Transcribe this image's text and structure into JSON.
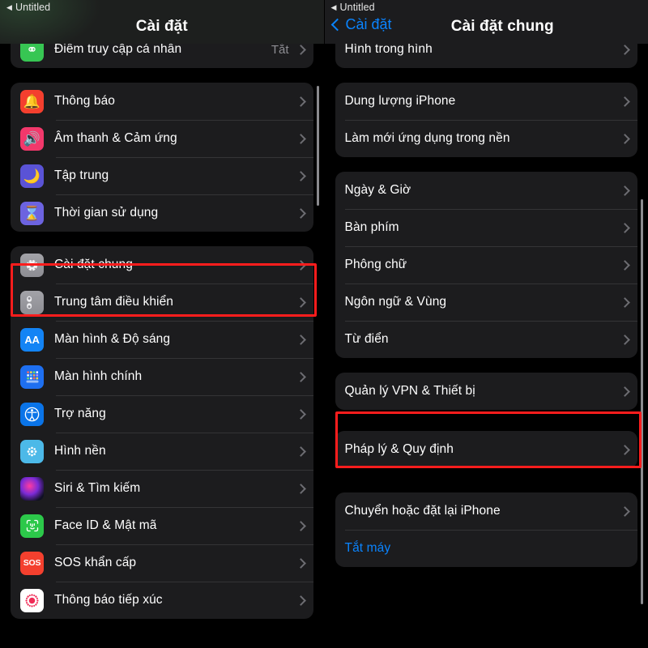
{
  "window": {
    "title": "Untitled",
    "back_glyph": "◀"
  },
  "left_screen": {
    "nav": {
      "title": "Cài đặt"
    },
    "scroll_groups": [
      {
        "name": "partial-top-group",
        "rows": [
          {
            "label": "Điểm truy cập cá nhân",
            "value": "Tắt",
            "icon": "hotspot-icon",
            "chevron": true
          }
        ]
      },
      {
        "name": "notifications-group",
        "rows": [
          {
            "label": "Thông báo",
            "value": "",
            "icon": "bell-icon",
            "chevron": true
          },
          {
            "label": "Âm thanh & Cảm ứng",
            "value": "",
            "icon": "speaker-icon",
            "chevron": true
          },
          {
            "label": "Tập trung",
            "value": "",
            "icon": "moon-icon",
            "chevron": true
          },
          {
            "label": "Thời gian sử dụng",
            "value": "",
            "icon": "hourglass-icon",
            "chevron": true
          }
        ]
      },
      {
        "name": "system-group",
        "rows": [
          {
            "label": "Cài đặt chung",
            "value": "",
            "icon": "gear-icon",
            "chevron": true
          },
          {
            "label": "Trung tâm điều khiển",
            "value": "",
            "icon": "control-center-icon",
            "chevron": true
          },
          {
            "label": "Màn hình & Độ sáng",
            "value": "",
            "icon": "display-aa-icon",
            "chevron": true
          },
          {
            "label": "Màn hình chính",
            "value": "",
            "icon": "home-screen-icon",
            "chevron": true
          },
          {
            "label": "Trợ năng",
            "value": "",
            "icon": "accessibility-icon",
            "chevron": true
          },
          {
            "label": "Hình nền",
            "value": "",
            "icon": "wallpaper-icon",
            "chevron": true
          },
          {
            "label": "Siri & Tìm kiếm",
            "value": "",
            "icon": "siri-icon",
            "chevron": true
          },
          {
            "label": "Face ID & Mật mã",
            "value": "",
            "icon": "faceid-icon",
            "chevron": true
          },
          {
            "label": "SOS khẩn cấp",
            "value": "",
            "icon": "sos-icon",
            "chevron": true
          },
          {
            "label": "Thông báo tiếp xúc",
            "value": "",
            "icon": "exposure-notification-icon",
            "chevron": true
          }
        ]
      }
    ],
    "highlight": {
      "target_label": "Cài đặt chung",
      "color": "#ff1d1d"
    }
  },
  "right_screen": {
    "nav": {
      "back_label": "Cài đặt",
      "title": "Cài đặt chung"
    },
    "scroll_groups": [
      {
        "name": "partial-top-group",
        "rows": [
          {
            "label": "Hình trong hình",
            "value": "",
            "chevron": true
          }
        ]
      },
      {
        "name": "storage-group",
        "rows": [
          {
            "label": "Dung lượng iPhone",
            "value": "",
            "chevron": true
          },
          {
            "label": "Làm mới ứng dụng trong nền",
            "value": "",
            "chevron": true
          }
        ]
      },
      {
        "name": "locale-group",
        "rows": [
          {
            "label": "Ngày & Giờ",
            "value": "",
            "chevron": true
          },
          {
            "label": "Bàn phím",
            "value": "",
            "chevron": true
          },
          {
            "label": "Phông chữ",
            "value": "",
            "chevron": true
          },
          {
            "label": "Ngôn ngữ & Vùng",
            "value": "",
            "chevron": true
          },
          {
            "label": "Từ điển",
            "value": "",
            "chevron": true
          }
        ]
      },
      {
        "name": "vpn-group",
        "rows": [
          {
            "label": "Quản lý VPN & Thiết bị",
            "value": "",
            "chevron": true
          }
        ]
      },
      {
        "name": "legal-group",
        "rows": [
          {
            "label": "Pháp lý & Quy định",
            "value": "",
            "chevron": true
          }
        ]
      },
      {
        "name": "reset-group",
        "rows": [
          {
            "label": "Chuyển hoặc đặt lại iPhone",
            "value": "",
            "chevron": true
          },
          {
            "label": "Tắt máy",
            "value": "",
            "chevron": false,
            "style": "blue"
          }
        ]
      }
    ],
    "highlight": {
      "target_label": "Quản lý VPN & Thiết bị",
      "color": "#ff1d1d"
    }
  }
}
